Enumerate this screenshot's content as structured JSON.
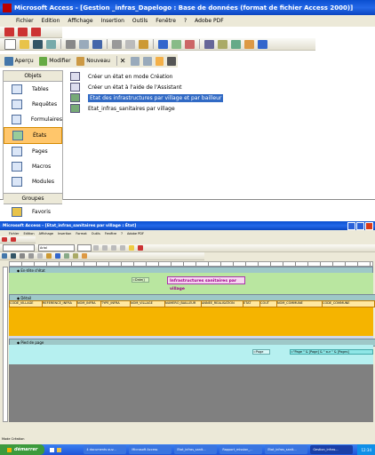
{
  "top": {
    "title": "Microsoft Access - [Gestion _infras_Dapelogo : Base de données (format de fichier Access 2000)]",
    "menu": [
      "Fichier",
      "Edition",
      "Affichage",
      "Insertion",
      "Outils",
      "Fenêtre",
      "?",
      "Adobe PDF"
    ],
    "db_toolbar": {
      "apercu": "Aperçu",
      "modifier": "Modifier",
      "nouveau": "Nouveau"
    },
    "sidebar": {
      "header": "Objets",
      "items": [
        "Tables",
        "Requêtes",
        "Formulaires",
        "États",
        "Pages",
        "Macros",
        "Modules"
      ],
      "groups_header": "Groupes",
      "favorites": "Favoris"
    },
    "reports": [
      "Créer un état en mode Création",
      "Créer un état à l'aide de l'Assistant",
      "Etat des infrastructures par village et par bailleur",
      "Etat_infras_sanitaires par village"
    ]
  },
  "bottom": {
    "title": "Microsoft Access - [Etat_infras_sanitaires par village : État]",
    "menu": [
      "Fichier",
      "Edition",
      "Affichage",
      "Insertion",
      "Format",
      "Outils",
      "Fenêtre",
      "?",
      "Adobe PDF"
    ],
    "font_box": "Arial",
    "section_entete_etat": "◆ En-tête d'état",
    "section_detail": "◆ Détail",
    "section_pied": "◆ Pied de page",
    "date_label": "=Date()",
    "report_title": "Infrastructures sanitaires par village",
    "fields": [
      "CODE_VILLAGE",
      "REFERENCE_INFRA",
      "NOM_INFRA",
      "TYPE_INFRA",
      "NOM_VILLAGE",
      "NUMERO_BAILLEUR",
      "ANNEE_REALISATION",
      "ETAT",
      "COUT",
      "NOM_COMMUNE",
      "CODE_COMMUNE"
    ],
    "page_expr": "=\"Page \" & [Page] & \" sur \" & [Pages]",
    "page_label": "=Page",
    "status": "Mode Création",
    "taskbar": {
      "start": "démarrer",
      "buttons": [
        "4 documents ouv...",
        "Microsoft Access",
        "Etat_infras_sanit...",
        "Rapport_mission_...",
        "Etat_infras_sanit...",
        "Gestion_infras..."
      ],
      "clock": "12:34"
    }
  }
}
